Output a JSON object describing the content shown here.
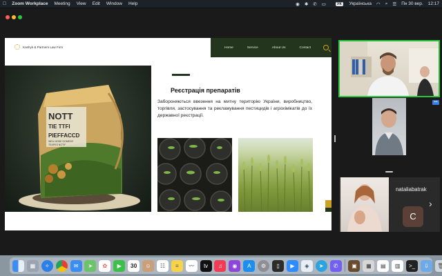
{
  "menubar": {
    "apple": "",
    "app_name": "Zoom Workplace",
    "items": [
      "Meeting",
      "View",
      "Edit",
      "Window",
      "Help"
    ],
    "keyboard_layout_badge": "УК",
    "keyboard_layout": "Українська",
    "datetime": "Пн 30 вер.",
    "time": "12:17"
  },
  "slide": {
    "company": "Kashyk & Partners Law Firm",
    "nav": [
      "Home",
      "Service",
      "About Us",
      "Contact"
    ],
    "bag_text": [
      "NOTT",
      "TIE TTFI",
      "PIEFFACCD",
      "WEIL NODE DOMEDS",
      "TEAPES NOTIF"
    ],
    "title": "Реєстрація препаратів",
    "body": "Забороняються ввезення на митну територію України, виробництво, торгівля, застосування та рекламування пестицидів і агрохімікатів до їх державної реєстрації."
  },
  "participants": {
    "tile3_name": "nataliabatrak",
    "tile3_avatar_letter": "C",
    "badge": "•••"
  },
  "dock": {
    "calendar_day": "30",
    "icons": [
      "finder-icon",
      "launchpad-icon",
      "safari-icon",
      "chrome-icon",
      "mail-icon",
      "maps-icon",
      "photos-icon",
      "facetime-icon",
      "calendar-icon",
      "contacts-icon",
      "reminders-icon",
      "notes-icon",
      "freeform-icon",
      "appletv-icon",
      "music-icon",
      "podcasts-icon",
      "app-store-icon",
      "system-settings-icon",
      "iphone-mirroring-icon",
      "zoom-icon",
      "vpn-icon",
      "telegram-icon",
      "viber-icon",
      "preview-icon",
      "calculator-icon",
      "chart-icon",
      "activity-monitor-icon",
      "terminal-icon",
      "downloads-icon",
      "trash-icon"
    ]
  },
  "colors": {
    "nav_green": "#23351c",
    "accent_gold": "#c9a227",
    "active_speaker": "#27c93f"
  }
}
